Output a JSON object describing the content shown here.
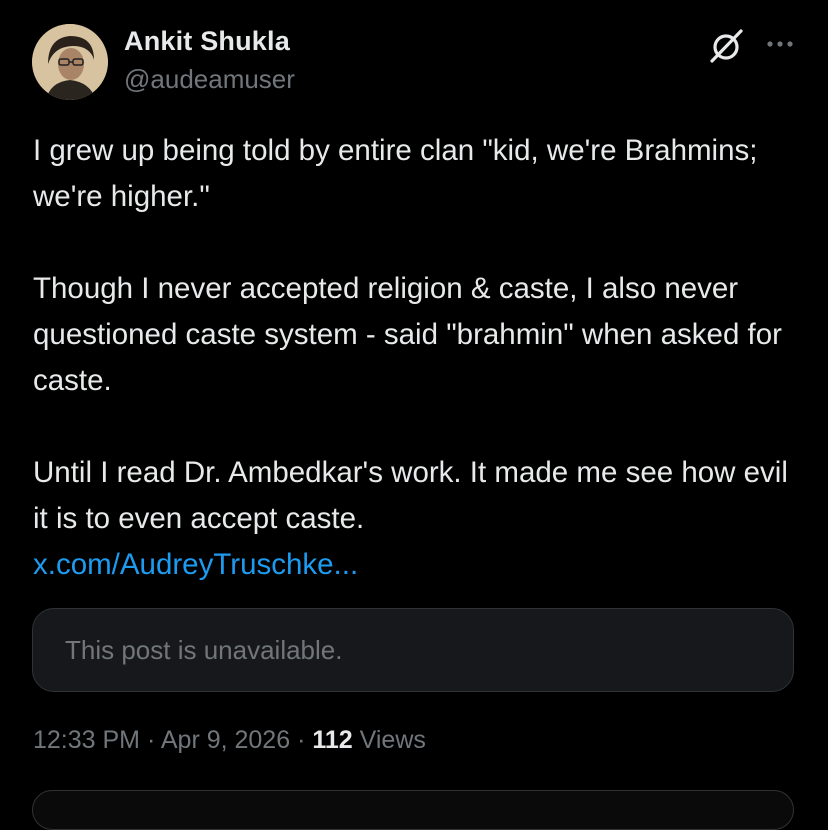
{
  "author": {
    "name": "Ankit Shukla",
    "handle": "@audeamuser",
    "avatar_icon": "profile-photo"
  },
  "header_icons": {
    "grok": "grok-icon",
    "more": "more-options-icon"
  },
  "post": {
    "paragraphs": [
      "I grew up being told by entire clan \"kid, we're Brahmins; we're higher.\"",
      "Though I never accepted religion & caste, I also never questioned caste system - said \"brahmin\" when asked for caste.",
      "Until I read Dr. Ambedkar's work. It made me see how evil it is to even accept caste."
    ],
    "link_text": "x.com/AudreyTruschke..."
  },
  "quoted_post": {
    "unavailable_text": "This post is unavailable."
  },
  "meta": {
    "time": "12:33 PM",
    "separator": " · ",
    "date": "Apr 9, 2026",
    "separator2": " · ",
    "views_count": "112",
    "views_label": " Views"
  },
  "colors": {
    "background": "#000000",
    "text": "#e7e9ea",
    "muted": "#71767b",
    "link": "#1d9bf0",
    "card_bg": "#16181c",
    "border": "#2f3336"
  }
}
